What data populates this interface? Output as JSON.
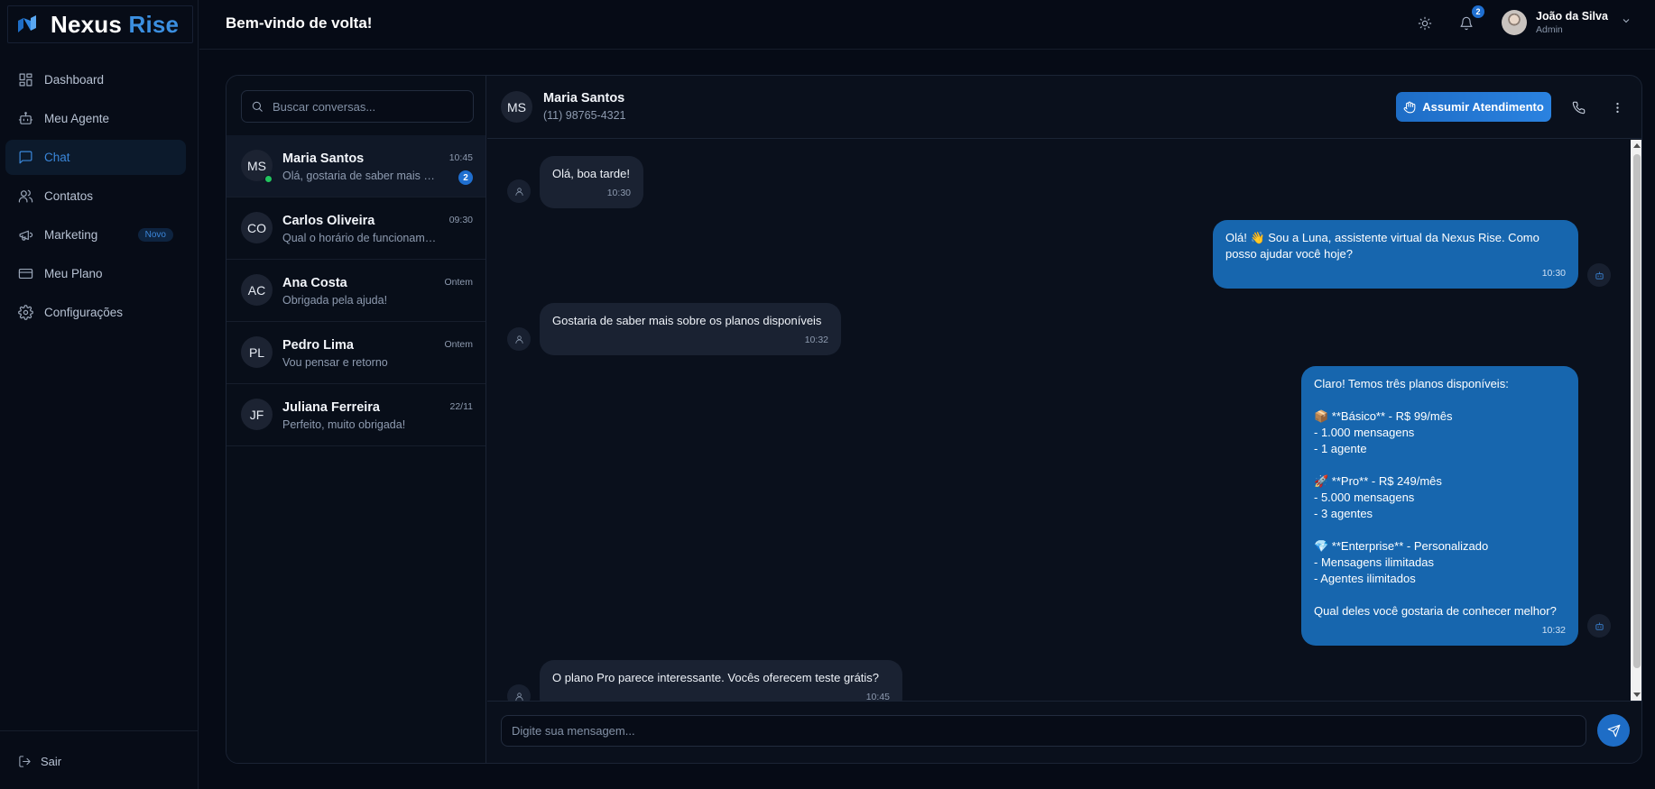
{
  "brand": {
    "name_primary": "Nexus",
    "name_accent": "Rise",
    "accent_color": "#3b8fe0"
  },
  "sidebar": {
    "items": [
      {
        "label": "Dashboard",
        "icon": "dashboard-icon"
      },
      {
        "label": "Meu Agente",
        "icon": "bot-icon"
      },
      {
        "label": "Chat",
        "icon": "chat-icon",
        "active": true
      },
      {
        "label": "Contatos",
        "icon": "users-icon"
      },
      {
        "label": "Marketing",
        "icon": "megaphone-icon",
        "badge": "Novo"
      },
      {
        "label": "Meu Plano",
        "icon": "credit-card-icon"
      },
      {
        "label": "Configurações",
        "icon": "gear-icon"
      }
    ],
    "logout_label": "Sair"
  },
  "header": {
    "welcome": "Bem-vindo de volta!",
    "notifications_count": "2",
    "user": {
      "name": "João da Silva",
      "role": "Admin"
    }
  },
  "conversations": {
    "search_placeholder": "Buscar conversas...",
    "items": [
      {
        "initials": "MS",
        "name": "Maria Santos",
        "preview": "Olá, gostaria de saber mais sobre os planos",
        "time": "10:45",
        "unread": "2",
        "online": true,
        "active": true
      },
      {
        "initials": "CO",
        "name": "Carlos Oliveira",
        "preview": "Qual o horário de funcionamento?",
        "time": "09:30"
      },
      {
        "initials": "AC",
        "name": "Ana Costa",
        "preview": "Obrigada pela ajuda!",
        "time": "Ontem"
      },
      {
        "initials": "PL",
        "name": "Pedro Lima",
        "preview": "Vou pensar e retorno",
        "time": "Ontem"
      },
      {
        "initials": "JF",
        "name": "Juliana Ferreira",
        "preview": "Perfeito, muito obrigada!",
        "time": "22/11"
      }
    ]
  },
  "chat": {
    "contact": {
      "initials": "MS",
      "name": "Maria Santos",
      "phone": "(11) 98765-4321"
    },
    "assume_label": "Assumir Atendimento",
    "messages": [
      {
        "from": "user",
        "text": "Olá, boa tarde!",
        "time": "10:30"
      },
      {
        "from": "bot",
        "text": "Olá! 👋 Sou a Luna, assistente virtual da Nexus Rise. Como\nposso ajudar você hoje?",
        "time": "10:30"
      },
      {
        "from": "user",
        "text": "Gostaria de saber mais sobre os planos disponíveis",
        "time": "10:32"
      },
      {
        "from": "bot",
        "text": "Claro! Temos três planos disponíveis:\n\n📦 **Básico** - R$ 99/mês\n- 1.000 mensagens\n- 1 agente\n\n🚀 **Pro** - R$ 249/mês\n- 5.000 mensagens\n- 3 agentes\n\n💎 **Enterprise** - Personalizado\n- Mensagens ilimitadas\n- Agentes ilimitados\n\nQual deles você gostaria de conhecer melhor?",
        "time": "10:32"
      },
      {
        "from": "user",
        "text": "O plano Pro parece interessante. Vocês oferecem teste grátis?",
        "time": "10:45"
      }
    ],
    "composer_placeholder": "Digite sua mensagem..."
  }
}
